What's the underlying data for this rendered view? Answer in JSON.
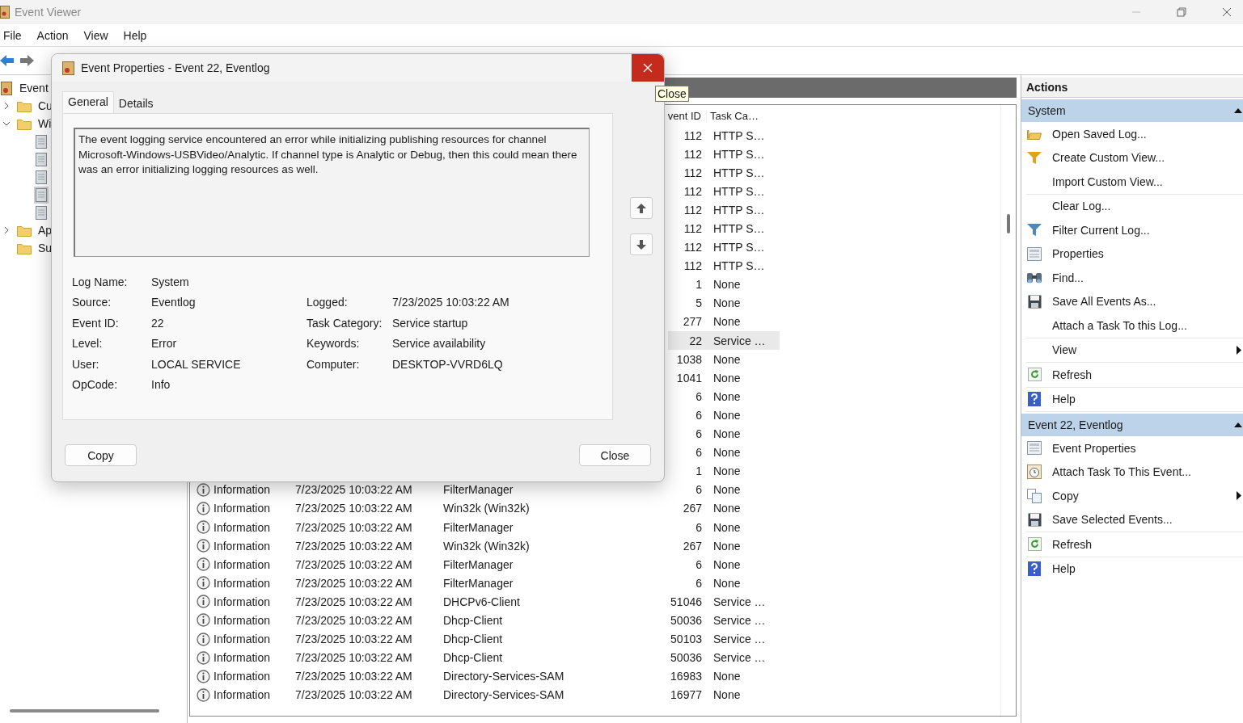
{
  "window": {
    "title": "Event Viewer"
  },
  "menu": [
    "File",
    "Action",
    "View",
    "Help"
  ],
  "tree": [
    {
      "label": "Event",
      "children": [
        {
          "label": "Cu",
          "expanded": false
        },
        {
          "label": "Wi",
          "expanded": true,
          "children": [
            {
              "selected": false
            },
            {
              "selected": false
            },
            {
              "selected": false
            },
            {
              "selected": true
            },
            {
              "selected": false
            }
          ]
        },
        {
          "label": "Ap",
          "expanded": false
        },
        {
          "label": "Su"
        }
      ]
    }
  ],
  "table": {
    "columns": [
      "vent ID",
      "Task Ca…"
    ],
    "rows": [
      {
        "event_id": "112",
        "task_category": "HTTP S…",
        "selected": false
      },
      {
        "event_id": "112",
        "task_category": "HTTP S…",
        "selected": false
      },
      {
        "event_id": "112",
        "task_category": "HTTP S…",
        "selected": false
      },
      {
        "event_id": "112",
        "task_category": "HTTP S…",
        "selected": false
      },
      {
        "event_id": "112",
        "task_category": "HTTP S…",
        "selected": false
      },
      {
        "event_id": "112",
        "task_category": "HTTP S…",
        "selected": false
      },
      {
        "event_id": "112",
        "task_category": "HTTP S…",
        "selected": false
      },
      {
        "event_id": "112",
        "task_category": "HTTP S…",
        "selected": false
      },
      {
        "event_id": "1",
        "task_category": "None",
        "selected": false
      },
      {
        "event_id": "5",
        "task_category": "None",
        "selected": false
      },
      {
        "event_id": "277",
        "task_category": "None",
        "selected": false
      },
      {
        "event_id": "22",
        "task_category": "Service …",
        "selected": true
      },
      {
        "event_id": "1038",
        "task_category": "None",
        "selected": false
      },
      {
        "event_id": "1041",
        "task_category": "None",
        "selected": false
      },
      {
        "event_id": "6",
        "task_category": "None",
        "selected": false
      },
      {
        "event_id": "6",
        "task_category": "None",
        "selected": false
      },
      {
        "event_id": "6",
        "task_category": "None",
        "selected": false
      },
      {
        "event_id": "6",
        "task_category": "None",
        "selected": false
      },
      {
        "event_id": "1",
        "task_category": "None",
        "selected": false
      },
      {
        "level": "Information",
        "date": "7/23/2025 10:03:22 AM",
        "source": "FilterManager",
        "event_id": "6",
        "task_category": "None",
        "selected": false
      },
      {
        "level": "Information",
        "date": "7/23/2025 10:03:22 AM",
        "source": "Win32k (Win32k)",
        "event_id": "267",
        "task_category": "None",
        "selected": false
      },
      {
        "level": "Information",
        "date": "7/23/2025 10:03:22 AM",
        "source": "FilterManager",
        "event_id": "6",
        "task_category": "None",
        "selected": false
      },
      {
        "level": "Information",
        "date": "7/23/2025 10:03:22 AM",
        "source": "Win32k (Win32k)",
        "event_id": "267",
        "task_category": "None",
        "selected": false
      },
      {
        "level": "Information",
        "date": "7/23/2025 10:03:22 AM",
        "source": "FilterManager",
        "event_id": "6",
        "task_category": "None",
        "selected": false
      },
      {
        "level": "Information",
        "date": "7/23/2025 10:03:22 AM",
        "source": "FilterManager",
        "event_id": "6",
        "task_category": "None",
        "selected": false
      },
      {
        "level": "Information",
        "date": "7/23/2025 10:03:22 AM",
        "source": "DHCPv6-Client",
        "event_id": "51046",
        "task_category": "Service …",
        "selected": false
      },
      {
        "level": "Information",
        "date": "7/23/2025 10:03:22 AM",
        "source": "Dhcp-Client",
        "event_id": "50036",
        "task_category": "Service …",
        "selected": false
      },
      {
        "level": "Information",
        "date": "7/23/2025 10:03:22 AM",
        "source": "Dhcp-Client",
        "event_id": "50103",
        "task_category": "Service …",
        "selected": false
      },
      {
        "level": "Information",
        "date": "7/23/2025 10:03:22 AM",
        "source": "Dhcp-Client",
        "event_id": "50036",
        "task_category": "Service …",
        "selected": false
      },
      {
        "level": "Information",
        "date": "7/23/2025 10:03:22 AM",
        "source": "Directory-Services-SAM",
        "event_id": "16983",
        "task_category": "None",
        "selected": false
      },
      {
        "level": "Information",
        "date": "7/23/2025 10:03:22 AM",
        "source": "Directory-Services-SAM",
        "event_id": "16977",
        "task_category": "None",
        "selected": false
      }
    ]
  },
  "actions": {
    "title": "Actions",
    "sections": [
      {
        "title": "System",
        "expanded": true,
        "groups": [
          [
            {
              "label": "Open Saved Log..."
            },
            {
              "label": "Create Custom View..."
            },
            {
              "label": "Import Custom View..."
            }
          ],
          [
            {
              "label": "Clear Log..."
            },
            {
              "label": "Filter Current Log..."
            },
            {
              "label": "Properties"
            },
            {
              "label": "Find..."
            },
            {
              "label": "Save All Events As..."
            },
            {
              "label": "Attach a Task To this Log..."
            }
          ],
          [
            {
              "label": "View",
              "submenu": true
            }
          ],
          [
            {
              "label": "Refresh"
            }
          ],
          [
            {
              "label": "Help"
            }
          ]
        ]
      },
      {
        "title": "Event 22, Eventlog",
        "expanded": true,
        "groups": [
          [
            {
              "label": "Event Properties"
            },
            {
              "label": "Attach Task To This Event..."
            },
            {
              "label": "Copy",
              "submenu": true
            },
            {
              "label": "Save Selected Events..."
            }
          ],
          [
            {
              "label": "Refresh"
            }
          ],
          [
            {
              "label": "Help"
            }
          ]
        ]
      }
    ]
  },
  "dialog": {
    "title": "Event Properties - Event 22, Eventlog",
    "close_tooltip": "Close",
    "tabs": [
      {
        "label": "General",
        "selected": true
      },
      {
        "label": "Details",
        "selected": false
      }
    ],
    "description": "The event logging service encountered an error while initializing publishing resources for channel Microsoft-Windows-USBVideo/Analytic. If channel type is Analytic or Debug, then this could mean there was an error initializing logging resources as well.",
    "fields": [
      {
        "label": "Log Name:",
        "value": "System"
      },
      {
        "label": "Source:",
        "value": "Eventlog"
      },
      {
        "label": "Event ID:",
        "value": "22"
      },
      {
        "label": "Level:",
        "value": "Error"
      },
      {
        "label": "User:",
        "value": "LOCAL SERVICE"
      },
      {
        "label": "OpCode:",
        "value": "Info"
      }
    ],
    "fields_right": [
      {
        "label": "Logged:",
        "value": "7/23/2025 10:03:22 AM"
      },
      {
        "label": "Task Category:",
        "value": "Service startup"
      },
      {
        "label": "Keywords:",
        "value": "Service availability"
      },
      {
        "label": "Computer:",
        "value": "DESKTOP-VVRD6LQ"
      }
    ],
    "buttons": [
      "Copy",
      "Close"
    ]
  }
}
